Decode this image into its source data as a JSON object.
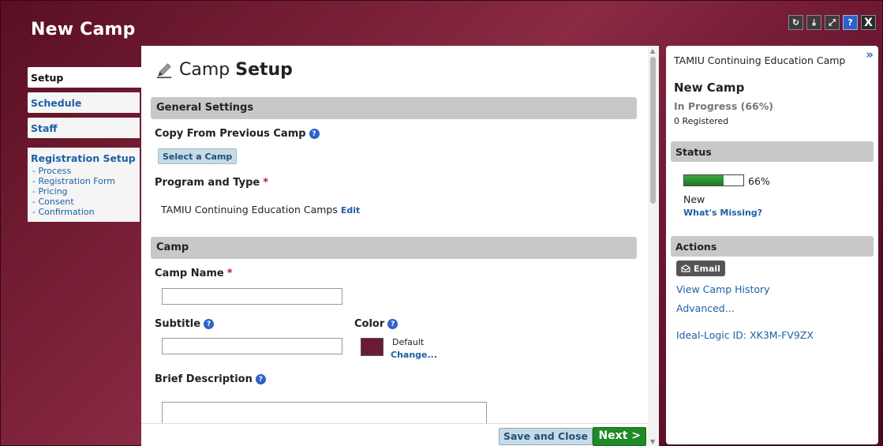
{
  "window": {
    "title": "New Camp",
    "controls": [
      "refresh-icon",
      "download-icon",
      "expand-icon",
      "help-icon",
      "close-icon"
    ]
  },
  "leftnav": {
    "tabs": [
      {
        "label": "Setup",
        "active": true
      },
      {
        "label": "Schedule",
        "active": false
      },
      {
        "label": "Staff",
        "active": false
      }
    ],
    "registration": {
      "title": "Registration Setup",
      "items": [
        "- Process",
        "- Registration Form",
        "- Pricing",
        "- Consent",
        "- Confirmation"
      ]
    }
  },
  "main": {
    "heading_light": "Camp ",
    "heading_bold": "Setup",
    "general_settings": "General Settings",
    "copy_label": "Copy From Previous Camp",
    "select_camp_button": "Select a Camp",
    "program_label": "Program and Type",
    "program_value": "TAMIU Continuing Education Camps",
    "edit_link": "Edit",
    "camp_section": "Camp",
    "camp_name_label": "Camp Name",
    "subtitle_label": "Subtitle",
    "color_label": "Color",
    "color_default": "Default",
    "color_change": "Change...",
    "brief_label": "Brief Description",
    "required_mark": "*",
    "save_close": "Save and Close",
    "next": "Next >"
  },
  "right": {
    "camp_type": "TAMIU Continuing Education Camp",
    "name": "New Camp",
    "progress_text": "In Progress (66%)",
    "registered": "0 Registered",
    "status_title": "Status",
    "progress_value": 0.66,
    "pct": "66%",
    "status": "New",
    "whats_missing": "What's Missing?",
    "actions_title": "Actions",
    "email_button": "Email",
    "view_history": "View Camp History",
    "advanced": "Advanced...",
    "ideal_logic_id": "Ideal-Logic ID: XK3M-FV9ZX"
  },
  "colors": {
    "brand": "#6b1530",
    "link": "#1f5fa5",
    "next_green": "#1f8a27",
    "camp_color": "#6b1b34"
  }
}
